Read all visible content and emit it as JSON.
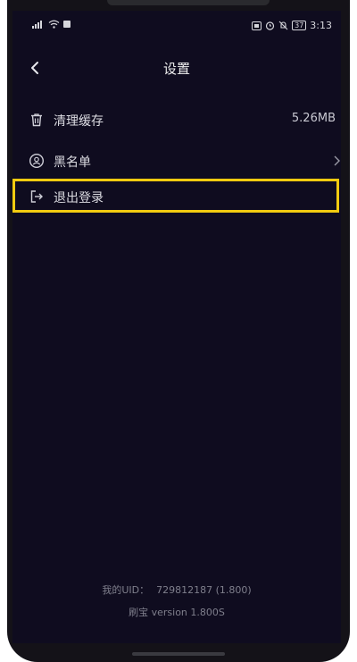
{
  "status": {
    "time": "3:13",
    "battery": "37"
  },
  "header": {
    "title": "设置"
  },
  "settings": {
    "items": [
      {
        "label": "清理缓存",
        "value": "5.26MB"
      },
      {
        "label": "黑名单"
      },
      {
        "label": "退出登录"
      }
    ]
  },
  "footer": {
    "uid_label": "我的UID：",
    "uid_value": "729812187 (1.800)",
    "version": "刷宝 version 1.800S"
  },
  "colors": {
    "background": "#0f0c1f",
    "highlight": "#f2cb10",
    "text": "#dcdce2"
  },
  "icons": [
    "back-arrow-icon",
    "trash-icon",
    "user-block-icon",
    "logout-icon",
    "chevron-right-icon"
  ]
}
